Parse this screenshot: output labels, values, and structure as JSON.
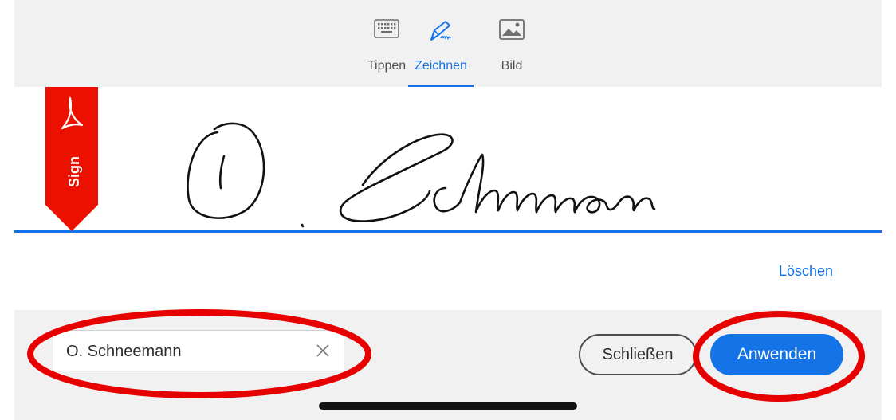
{
  "tabs": [
    {
      "label": "Tippen",
      "icon": "keyboard-icon",
      "active": false
    },
    {
      "label": "Zeichnen",
      "icon": "pen-draw-icon",
      "active": true
    },
    {
      "label": "Bild",
      "icon": "image-icon",
      "active": false
    }
  ],
  "ribbon": {
    "label": "Sign",
    "icon": "acrobat-logo-icon",
    "color": "#eb1000"
  },
  "canvas": {
    "clear_label": "Löschen",
    "signature_icon": "handwritten-signature"
  },
  "footer": {
    "name_value": "O. Schneemann",
    "close_label": "Schließen",
    "apply_label": "Anwenden"
  },
  "colors": {
    "accent": "#1473e6",
    "annotation": "#e60000"
  }
}
